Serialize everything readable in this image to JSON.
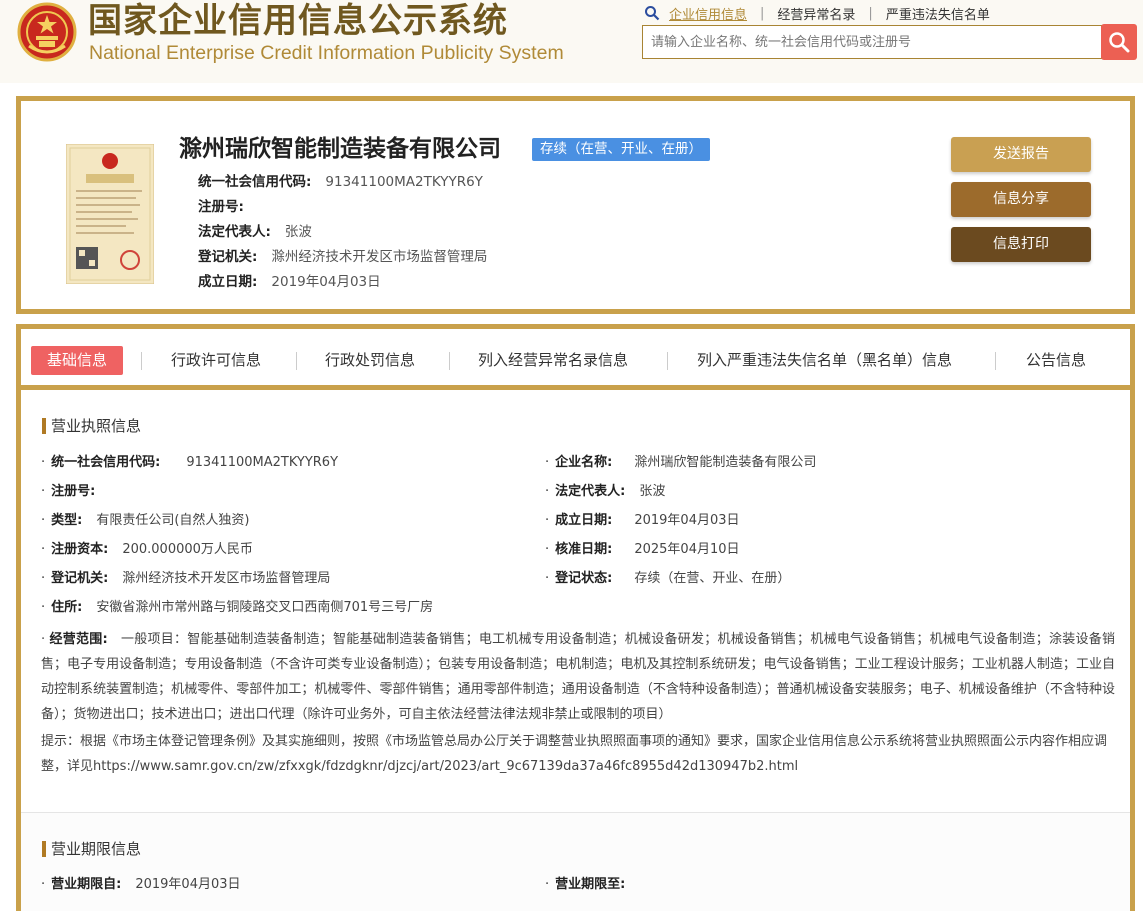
{
  "header": {
    "title_cn": "国家企业信用信息公示系统",
    "title_en": "National Enterprise Credit Information Publicity System",
    "search_tabs": [
      "企业信用信息",
      "经营异常名录",
      "严重违法失信名单"
    ],
    "search_placeholder": "请输入企业名称、统一社会信用代码或注册号"
  },
  "company": {
    "name": "滁州瑞欣智能制造装备有限公司",
    "status": "存续（在营、开业、在册）",
    "fields": [
      {
        "label": "统一社会信用代码:",
        "value": "91341100MA2TKYYR6Y"
      },
      {
        "label": "注册号:",
        "value": ""
      },
      {
        "label": "法定代表人:",
        "value": "张波"
      },
      {
        "label": "登记机关:",
        "value": "滁州经济技术开发区市场监督管理局"
      },
      {
        "label": "成立日期:",
        "value": "2019年04月03日"
      }
    ],
    "buttons": [
      "发送报告",
      "信息分享",
      "信息打印"
    ]
  },
  "tabs": [
    "基础信息",
    "行政许可信息",
    "行政处罚信息",
    "列入经营异常名录信息",
    "列入严重违法失信名单（黑名单）信息",
    "公告信息"
  ],
  "license_section": {
    "title": "营业执照信息",
    "left": [
      {
        "label": "统一社会信用代码:",
        "value": "91341100MA2TKYYR6Y"
      },
      {
        "label": "注册号:",
        "value": ""
      },
      {
        "label": "类型:",
        "value": "有限责任公司(自然人独资)"
      },
      {
        "label": "注册资本:",
        "value": "200.000000万人民币"
      },
      {
        "label": "登记机关:",
        "value": "滁州经济技术开发区市场监督管理局"
      },
      {
        "label": "住所:",
        "value": "安徽省滁州市常州路与铜陵路交叉口西南侧701号三号厂房"
      }
    ],
    "right": [
      {
        "label": "企业名称:",
        "value": "滁州瑞欣智能制造装备有限公司"
      },
      {
        "label": "法定代表人:",
        "value": "张波"
      },
      {
        "label": "成立日期:",
        "value": "2019年04月03日"
      },
      {
        "label": "核准日期:",
        "value": "2025年04月10日"
      },
      {
        "label": "登记状态:",
        "value": "存续（在营、开业、在册）"
      }
    ],
    "scope_label": "经营范围:",
    "scope_value": "一般项目：智能基础制造装备制造；智能基础制造装备销售；电工机械专用设备制造；机械设备研发；机械设备销售；机械电气设备销售；机械电气设备制造；涂装设备销售；电子专用设备制造；专用设备制造（不含许可类专业设备制造）；包装专用设备制造；电机制造；电机及其控制系统研发；电气设备销售；工业工程设计服务；工业机器人制造；工业自动控制系统装置制造；机械零件、零部件加工；机械零件、零部件销售；通用零部件制造；通用设备制造（不含特种设备制造）；普通机械设备安装服务；电子、机械设备维护（不含特种设备）；货物进出口；技术进出口；进出口代理（除许可业务外，可自主依法经营法律法规非禁止或限制的项目）",
    "notice": "提示：根据《市场主体登记管理条例》及其实施细则，按照《市场监管总局办公厅关于调整营业执照照面事项的通知》要求，国家企业信用信息公示系统将营业执照照面公示内容作相应调整，详见https://www.samr.gov.cn/zw/zfxxgk/fdzdgknr/djzcj/art/2023/art_9c67139da37a46fc8955d42d130947b2.html"
  },
  "term_section": {
    "title": "营业期限信息",
    "from_label": "营业期限自:",
    "from_value": "2019年04月03日",
    "to_label": "营业期限至:",
    "to_value": ""
  }
}
